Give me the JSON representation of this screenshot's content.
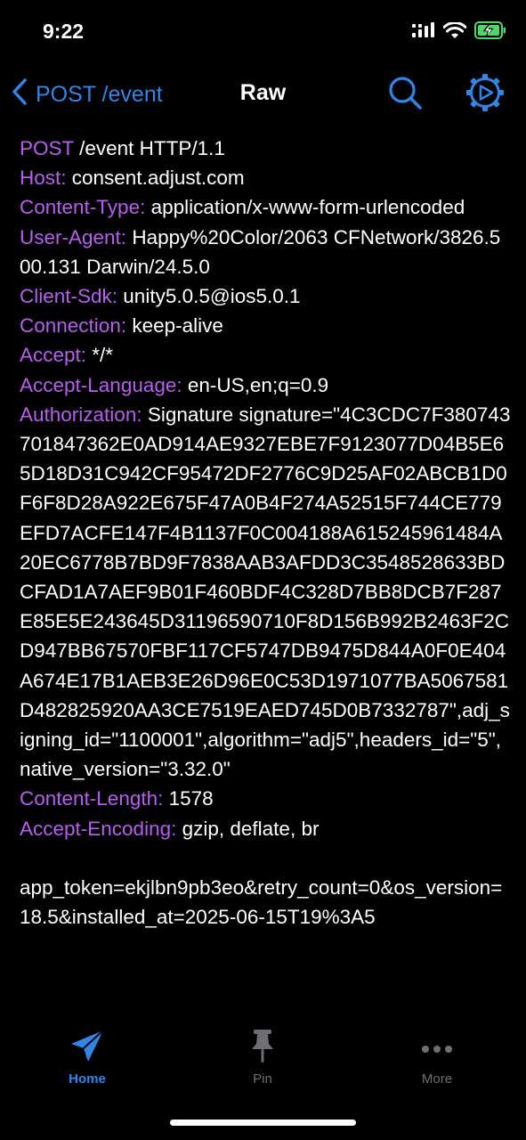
{
  "status": {
    "time": "9:22"
  },
  "nav": {
    "back_label": "POST /event",
    "title": "Raw"
  },
  "request": {
    "method": "POST",
    "path_line": " /event HTTP/1.1",
    "headers": [
      {
        "key": "Host:",
        "value": " consent.adjust.com"
      },
      {
        "key": "Content-Type:",
        "value": " application/x-www-form-urlencoded"
      },
      {
        "key": "User-Agent:",
        "value": " Happy%20Color/2063 CFNetwork/3826.500.131 Darwin/24.5.0"
      },
      {
        "key": "Client-Sdk:",
        "value": " unity5.0.5@ios5.0.1"
      },
      {
        "key": "Connection:",
        "value": " keep-alive"
      },
      {
        "key": "Accept:",
        "value": " */*"
      },
      {
        "key": "Accept-Language:",
        "value": " en-US,en;q=0.9"
      },
      {
        "key": "Authorization:",
        "value": " Signature signature=\"4C3CDC7F380743701847362E0AD914AE9327EBE7F9123077D04B5E65D18D31C942CF95472DF2776C9D25AF02ABCB1D0F6F8D28A922E675F47A0B4F274A52515F744CE779EFD7ACFE147F4B1137F0C004188A615245961484A20EC6778B7BD9F7838AAB3AFDD3C3548528633BDCFAD1A7AEF9B01F460BDF4C328D7BB8DCB7F287E85E5E243645D31196590710F8D156B992B2463F2CD947BB67570FBF117CF5747DB9475D844A0F0E404A674E17B1AEB3E26D96E0C53D1971077BA5067581D482825920AA3CE7519EAED745D0B7332787\",adj_signing_id=\"1100001\",algorithm=\"adj5\",headers_id=\"5\",native_version=\"3.32.0\""
      },
      {
        "key": "Content-Length:",
        "value": " 1578"
      },
      {
        "key": "Accept-Encoding:",
        "value": " gzip, deflate, br"
      }
    ],
    "body": "app_token=ekjlbn9pb3eo&retry_count=0&os_version=18.5&installed_at=2025-06-15T19%3A5"
  },
  "tabs": [
    {
      "label": "Home",
      "icon": "paper-plane-icon",
      "selected": true
    },
    {
      "label": "Pin",
      "icon": "pin-icon",
      "selected": false
    },
    {
      "label": "More",
      "icon": "ellipsis-icon",
      "selected": false
    }
  ],
  "colors": {
    "accent": "#2f86e8",
    "header_key": "#b95cf2",
    "inactive_tab": "#6e6e73",
    "background": "#000000"
  }
}
